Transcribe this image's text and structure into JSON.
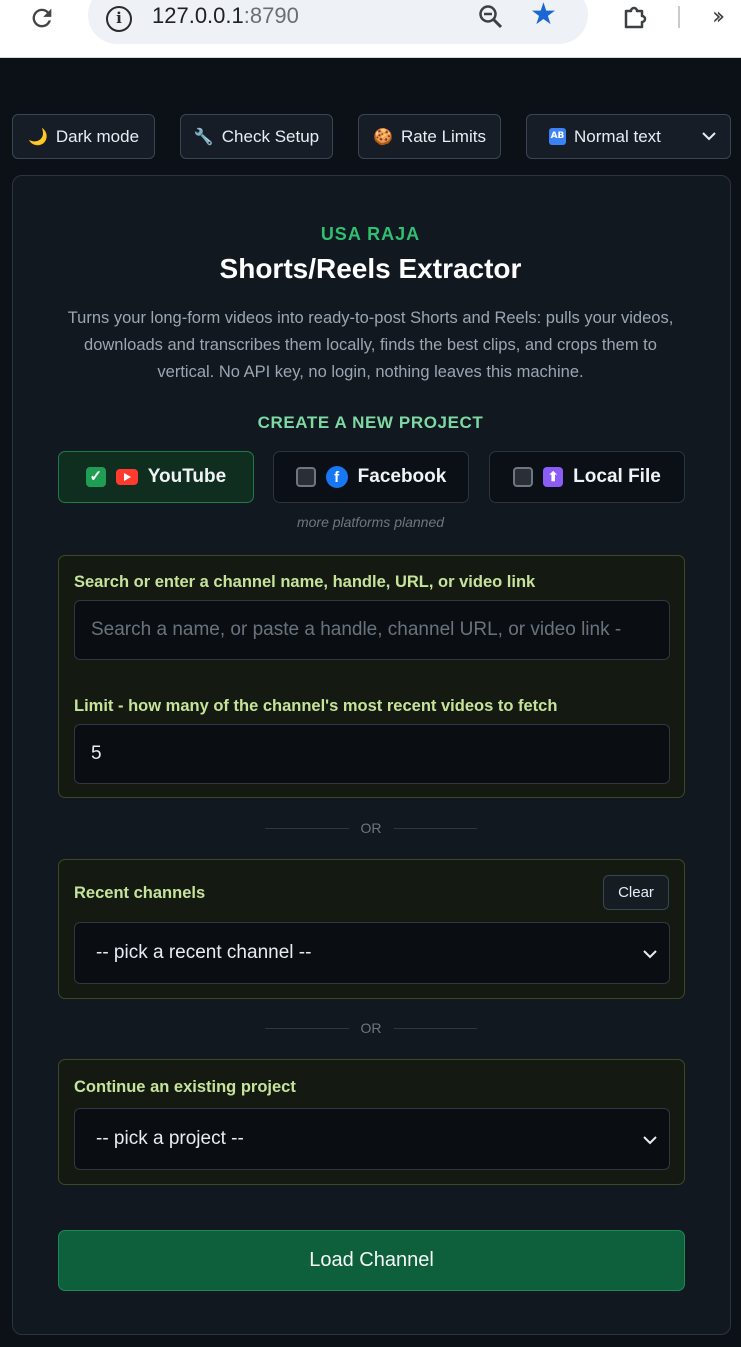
{
  "browser": {
    "url_host": "127.0.0.1",
    "url_port": ":8790"
  },
  "toolbar": {
    "dark_mode_label": "Dark mode",
    "check_setup_label": "Check Setup",
    "rate_limits_label": "Rate Limits",
    "text_size_selected": "Normal text"
  },
  "header": {
    "brand": "USA RAJA",
    "title": "Shorts/Reels Extractor",
    "description": "Turns your long-form videos into ready-to-post Shorts and Reels: pulls your videos, downloads and transcribes them locally, finds the best clips, and crops them to vertical. No API key, no login, nothing leaves this machine."
  },
  "create_project": {
    "heading": "CREATE A NEW PROJECT",
    "platforms": [
      {
        "label": "YouTube",
        "checked": true
      },
      {
        "label": "Facebook",
        "checked": false
      },
      {
        "label": "Local File",
        "checked": false
      }
    ],
    "note": "more platforms planned"
  },
  "search": {
    "label": "Search or enter a channel name, handle, URL, or video link",
    "placeholder": "Search a name, or paste a handle, channel URL, or video link -",
    "limit_label": "Limit - how many of the channel's most recent videos to fetch",
    "limit_value": "5"
  },
  "divider_text": "OR",
  "recent": {
    "label": "Recent channels",
    "clear_label": "Clear",
    "selected": "-- pick a recent channel --"
  },
  "project": {
    "label": "Continue an existing project",
    "selected": "-- pick a project --"
  },
  "load_button_label": "Load Channel"
}
